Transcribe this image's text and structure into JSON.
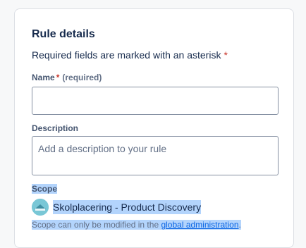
{
  "form": {
    "title": "Rule details",
    "required_note": "Required fields are marked with an asterisk",
    "asterisk": "*",
    "name_field": {
      "label": "Name",
      "asterisk": "*",
      "hint": "(required)",
      "value": ""
    },
    "description_field": {
      "label": "Description",
      "placeholder": "Add a description to your rule",
      "value": ""
    },
    "scope": {
      "label": "Scope",
      "avatar_icon": "project-avatar-icon",
      "project_name": "Skolplacering - Product Discovery",
      "note_prefix": "Scope can only be modified in the ",
      "note_link": "global administration",
      "note_suffix": "."
    }
  },
  "colors": {
    "selection_highlight": "#b3d4fc",
    "link": "#0c66e4",
    "required": "#c9372c"
  }
}
